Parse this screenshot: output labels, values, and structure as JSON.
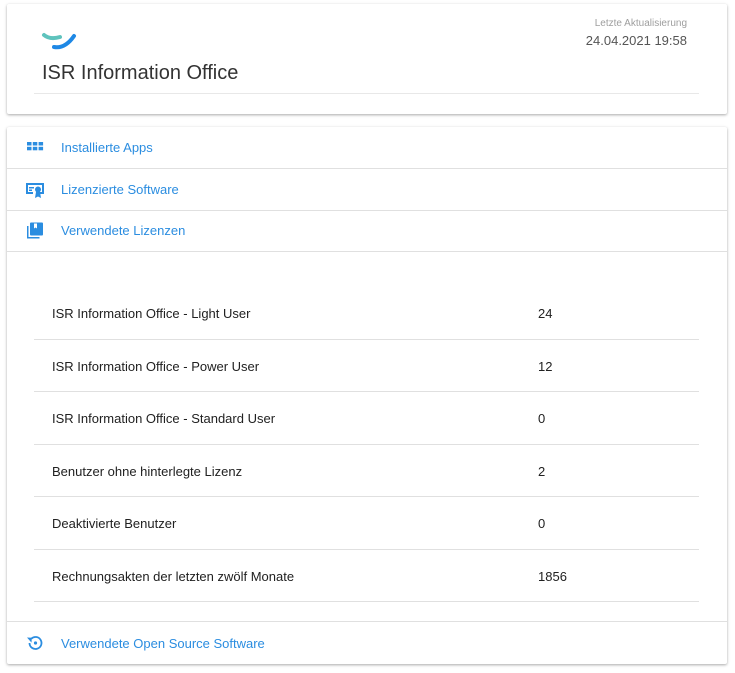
{
  "header": {
    "title": "ISR Information Office",
    "update_label": "Letzte Aktualisierung",
    "update_value": "24.04.2021 19:58"
  },
  "nav": {
    "apps": {
      "label": "Installierte Apps",
      "icon": "grid-icon"
    },
    "software": {
      "label": "Lizenzierte Software",
      "icon": "certificate-icon"
    },
    "licenses": {
      "label": "Verwendete Lizenzen",
      "icon": "library-books-icon"
    },
    "oss": {
      "label": "Verwendete Open Source Software",
      "icon": "history-icon"
    }
  },
  "licenses": [
    {
      "name": "ISR Information Office - Light User",
      "value": "24"
    },
    {
      "name": "ISR Information Office - Power User",
      "value": "12"
    },
    {
      "name": "ISR Information Office - Standard User",
      "value": "0"
    },
    {
      "name": "Benutzer ohne hinterlegte Lizenz",
      "value": "2"
    },
    {
      "name": "Deaktivierte Benutzer",
      "value": "0"
    },
    {
      "name": "Rechnungsakten der letzten zwölf Monate",
      "value": "1856"
    }
  ],
  "colors": {
    "accent": "#2b8de0",
    "logo_teal": "#5fc3bd",
    "logo_blue": "#1e88e5"
  }
}
